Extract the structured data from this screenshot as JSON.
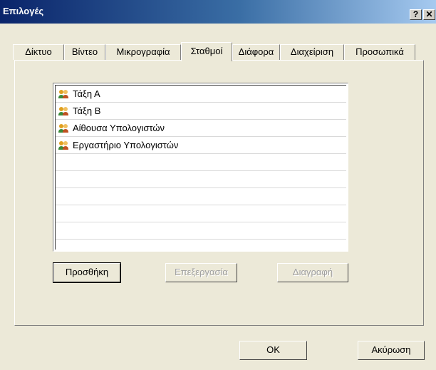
{
  "window": {
    "title": "Επιλογές",
    "help_label": "?",
    "close_label": "✕"
  },
  "tabs": [
    {
      "label": "Δίκτυο"
    },
    {
      "label": "Βίντεο"
    },
    {
      "label": "Μικρογραφία"
    },
    {
      "label": "Σταθμοί",
      "active": true
    },
    {
      "label": "Διάφορα"
    },
    {
      "label": "Διαχείριση"
    },
    {
      "label": "Προσωπικά"
    }
  ],
  "stations": [
    {
      "label": "Τάξη Α",
      "icon": "users-icon"
    },
    {
      "label": "Τάξη Β",
      "icon": "users-icon"
    },
    {
      "label": "Αίθουσα Υπολογιστών",
      "icon": "users-icon"
    },
    {
      "label": "Εργαστήριο Υπολογιστών",
      "icon": "users-icon"
    }
  ],
  "panel_buttons": {
    "add": "Προσθήκη",
    "edit": "Επεξεργασία",
    "delete": "Διαγραφή"
  },
  "footer": {
    "ok": "OK",
    "cancel": "Ακύρωση"
  }
}
